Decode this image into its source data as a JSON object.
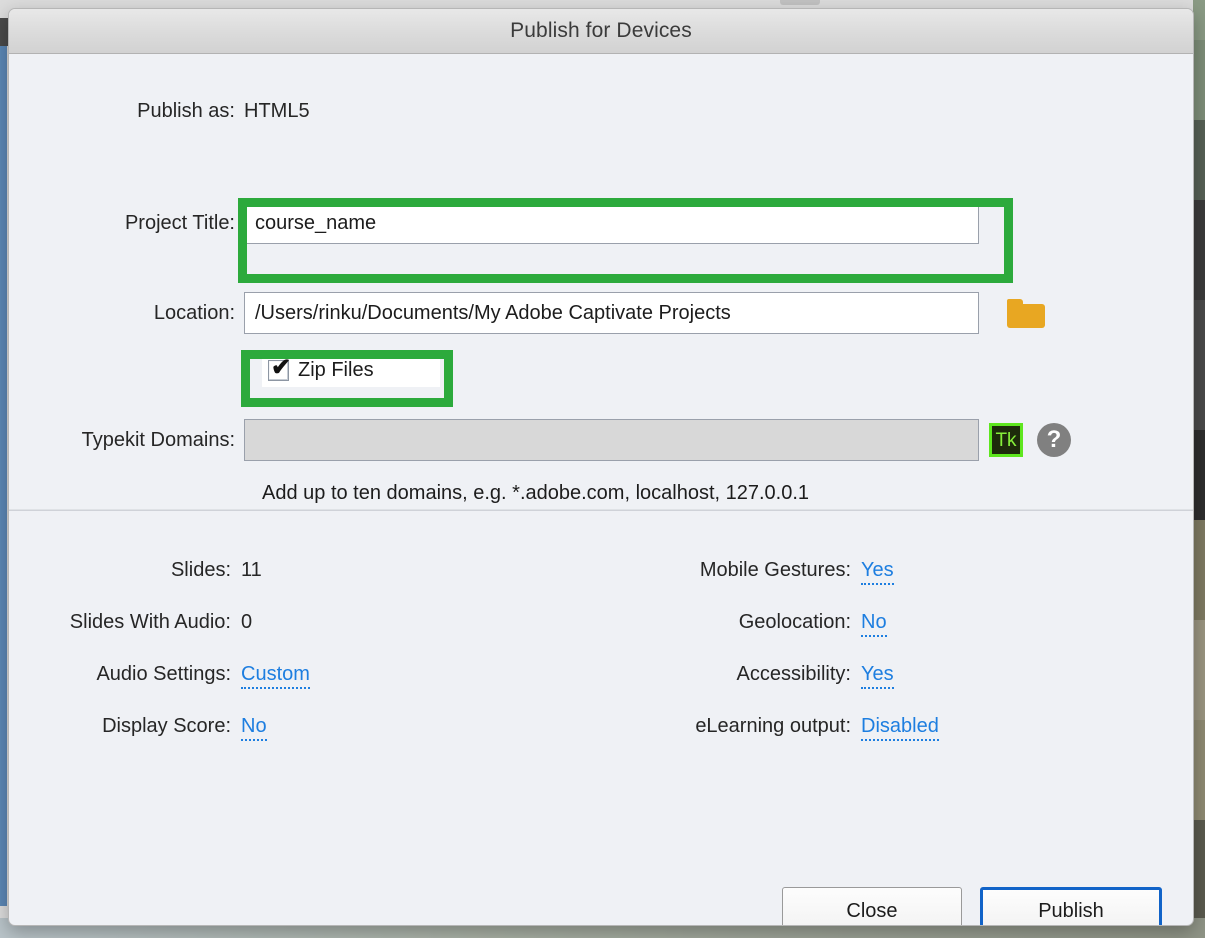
{
  "window": {
    "title": "Publish for Devices"
  },
  "form": {
    "publish_as": {
      "label": "Publish as:",
      "value": "HTML5"
    },
    "project_title": {
      "label": "Project Title:",
      "value": "course_name",
      "placeholder": ""
    },
    "location": {
      "label": "Location:",
      "value": "/Users/rinku/Documents/My Adobe Captivate Projects",
      "placeholder": ""
    },
    "browse_icon": "folder-icon",
    "zip_files": {
      "label": "Zip Files",
      "checked": true,
      "check_glyph": "✔"
    },
    "typekit_domains": {
      "label": "Typekit Domains:",
      "value": "",
      "placeholder": ""
    },
    "typekit_icon_label": "Tk",
    "help_icon_label": "?",
    "hint": "Add up to ten domains, e.g. *.adobe.com, localhost, 127.0.0.1"
  },
  "summary": {
    "left": [
      {
        "label": "Slides:",
        "value": "11",
        "is_link": false
      },
      {
        "label": "Slides With Audio:",
        "value": "0",
        "is_link": false
      },
      {
        "label": "Audio Settings:",
        "value": "Custom",
        "is_link": true
      },
      {
        "label": "Display Score:",
        "value": "No",
        "is_link": true
      }
    ],
    "right": [
      {
        "label": "Mobile Gestures:",
        "value": "Yes",
        "is_link": true
      },
      {
        "label": "Geolocation:",
        "value": "No",
        "is_link": true
      },
      {
        "label": "Accessibility:",
        "value": "Yes",
        "is_link": true
      },
      {
        "label": "eLearning output:",
        "value": "Disabled",
        "is_link": true
      }
    ]
  },
  "buttons": {
    "close": "Close",
    "publish": "Publish"
  },
  "colors": {
    "highlight_green": "#2caa3c",
    "link_blue": "#1d7ee0",
    "focus_blue": "#1163c8",
    "folder_orange": "#e8a722",
    "typekit_green": "#5ee61e"
  }
}
